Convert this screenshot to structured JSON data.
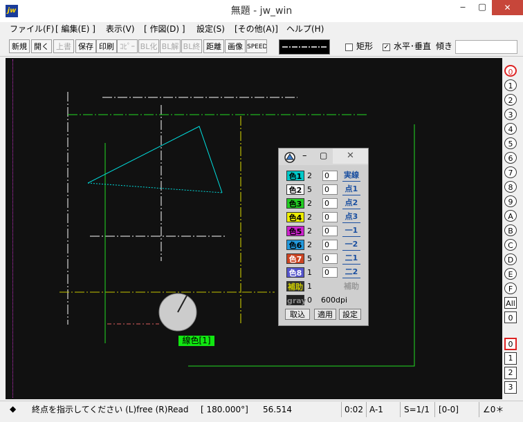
{
  "window": {
    "title": "無題 - jw_win",
    "app_icon": "jw",
    "minimize": "‒",
    "maximize": "▢",
    "close": "✕"
  },
  "menu": [
    "ファイル(F)",
    "[ 編集(E) ]",
    "表示(V)",
    "[ 作図(D) ]",
    "設定(S)",
    "[その他(A)]",
    "ヘルプ(H)"
  ],
  "toolbar": {
    "buttons": [
      "新規",
      "開く",
      "上書",
      "保存",
      "印刷",
      "ｺﾋﾟｰ",
      "BL化",
      "BL解",
      "BL終",
      "距離",
      "画像",
      "SPEED"
    ],
    "disabled": [
      "上書",
      "ｺﾋﾟｰ",
      "BL化",
      "BL解",
      "BL終"
    ],
    "rect_label": "矩形",
    "hv_label": "水平･垂直",
    "hv_checked": "✓",
    "tilt_label": "傾き",
    "tilt_value": ""
  },
  "layers": [
    "0",
    "1",
    "2",
    "3",
    "4",
    "5",
    "6",
    "7",
    "8",
    "9",
    "A",
    "B",
    "C",
    "D",
    "E",
    "F",
    "All",
    "0"
  ],
  "groups": [
    "0",
    "1",
    "2",
    "3"
  ],
  "palette": {
    "colors": [
      {
        "label": "色1",
        "num": "2",
        "val": "0",
        "style": "実線",
        "bg": "#00c8c8",
        "fg": "#000"
      },
      {
        "label": "色2",
        "num": "5",
        "val": "0",
        "style": "点1",
        "bg": "#ffffff",
        "fg": "#000"
      },
      {
        "label": "色3",
        "num": "2",
        "val": "0",
        "style": "点2",
        "bg": "#22cc22",
        "fg": "#000"
      },
      {
        "label": "色4",
        "num": "2",
        "val": "0",
        "style": "点3",
        "bg": "#eeee00",
        "fg": "#000"
      },
      {
        "label": "色5",
        "num": "2",
        "val": "0",
        "style": "一1",
        "bg": "#cc22cc",
        "fg": "#000"
      },
      {
        "label": "色6",
        "num": "2",
        "val": "0",
        "style": "一2",
        "bg": "#2299dd",
        "fg": "#000"
      },
      {
        "label": "色7",
        "num": "5",
        "val": "0",
        "style": "二1",
        "bg": "#cc4422",
        "fg": "#fff"
      },
      {
        "label": "色8",
        "num": "1",
        "val": "0",
        "style": "二2",
        "bg": "#5555cc",
        "fg": "#fff"
      }
    ],
    "aux_label": "補助",
    "aux_num": "1",
    "aux_style": "補助",
    "gray_label": "gray",
    "gray_num": "0",
    "dpi_text": "600dpi",
    "buttons": [
      "取込",
      "適用",
      "設定"
    ]
  },
  "tooltip": "線色[1]",
  "status": {
    "diamond": "◆",
    "message": "終点を指示してください  (L)free  (R)Read",
    "angle": "[ 180.000°]",
    "length": "56.514",
    "scale_time": "0:02",
    "paper": "A-1",
    "scale": "S=1/1",
    "layer": "[0-0]",
    "angle_mode": "∠0＊"
  },
  "colors": {
    "canvas": "#111111",
    "cyan": "#00e0e0",
    "green": "#22dd22",
    "yellow": "#e0e000",
    "white": "#ffffff",
    "accent": "#c7463a"
  }
}
